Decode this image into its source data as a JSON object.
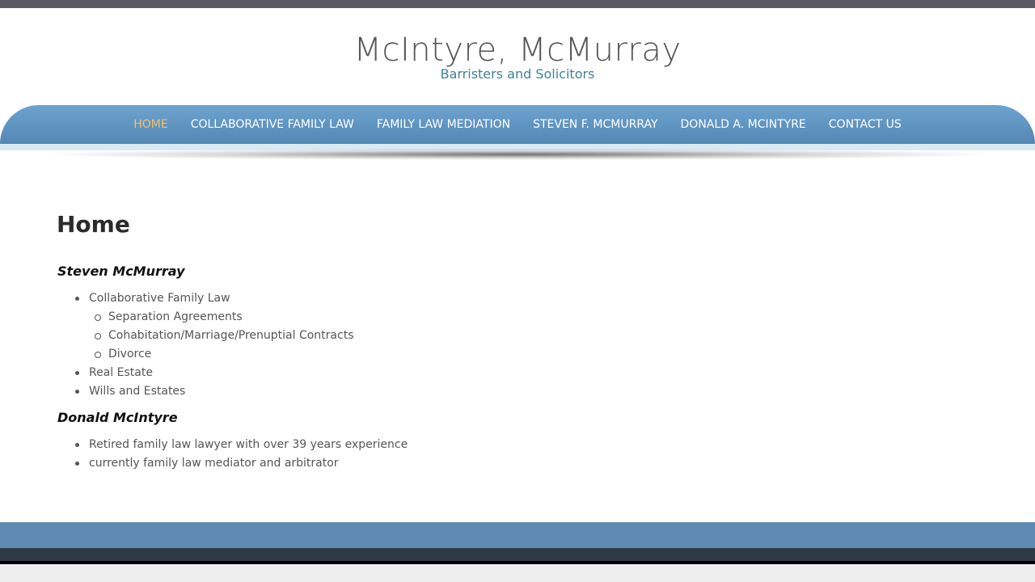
{
  "header": {
    "title": "McIntyre, McMurray",
    "tagline": "Barristers and Solicitors"
  },
  "nav": {
    "items": [
      {
        "label": "HOME",
        "active": true
      },
      {
        "label": "COLLABORATIVE FAMILY LAW"
      },
      {
        "label": "FAMILY LAW MEDIATION"
      },
      {
        "label": "STEVEN F. MCMURRAY"
      },
      {
        "label": "DONALD A. MCINTYRE"
      },
      {
        "label": "CONTACT US"
      }
    ]
  },
  "main": {
    "heading": "Home",
    "sections": [
      {
        "name": "Steven McMurray",
        "items": [
          {
            "label": "Collaborative Family Law",
            "sub": [
              "Separation Agreements",
              "Cohabitation/Marriage/Prenuptial Contracts",
              "Divorce"
            ]
          },
          {
            "label": "Real Estate"
          },
          {
            "label": "Wills and Estates"
          }
        ]
      },
      {
        "name": "Donald McIntyre",
        "items": [
          {
            "label": "Retired family law lawyer with over 39 years experience"
          },
          {
            "label": "currently family law mediator and arbitrator"
          }
        ]
      }
    ]
  },
  "colors": {
    "nav": "#5e92bf",
    "active_nav": "#f4c16b",
    "tagline": "#3f8294",
    "footer": "#5f8bb3"
  }
}
